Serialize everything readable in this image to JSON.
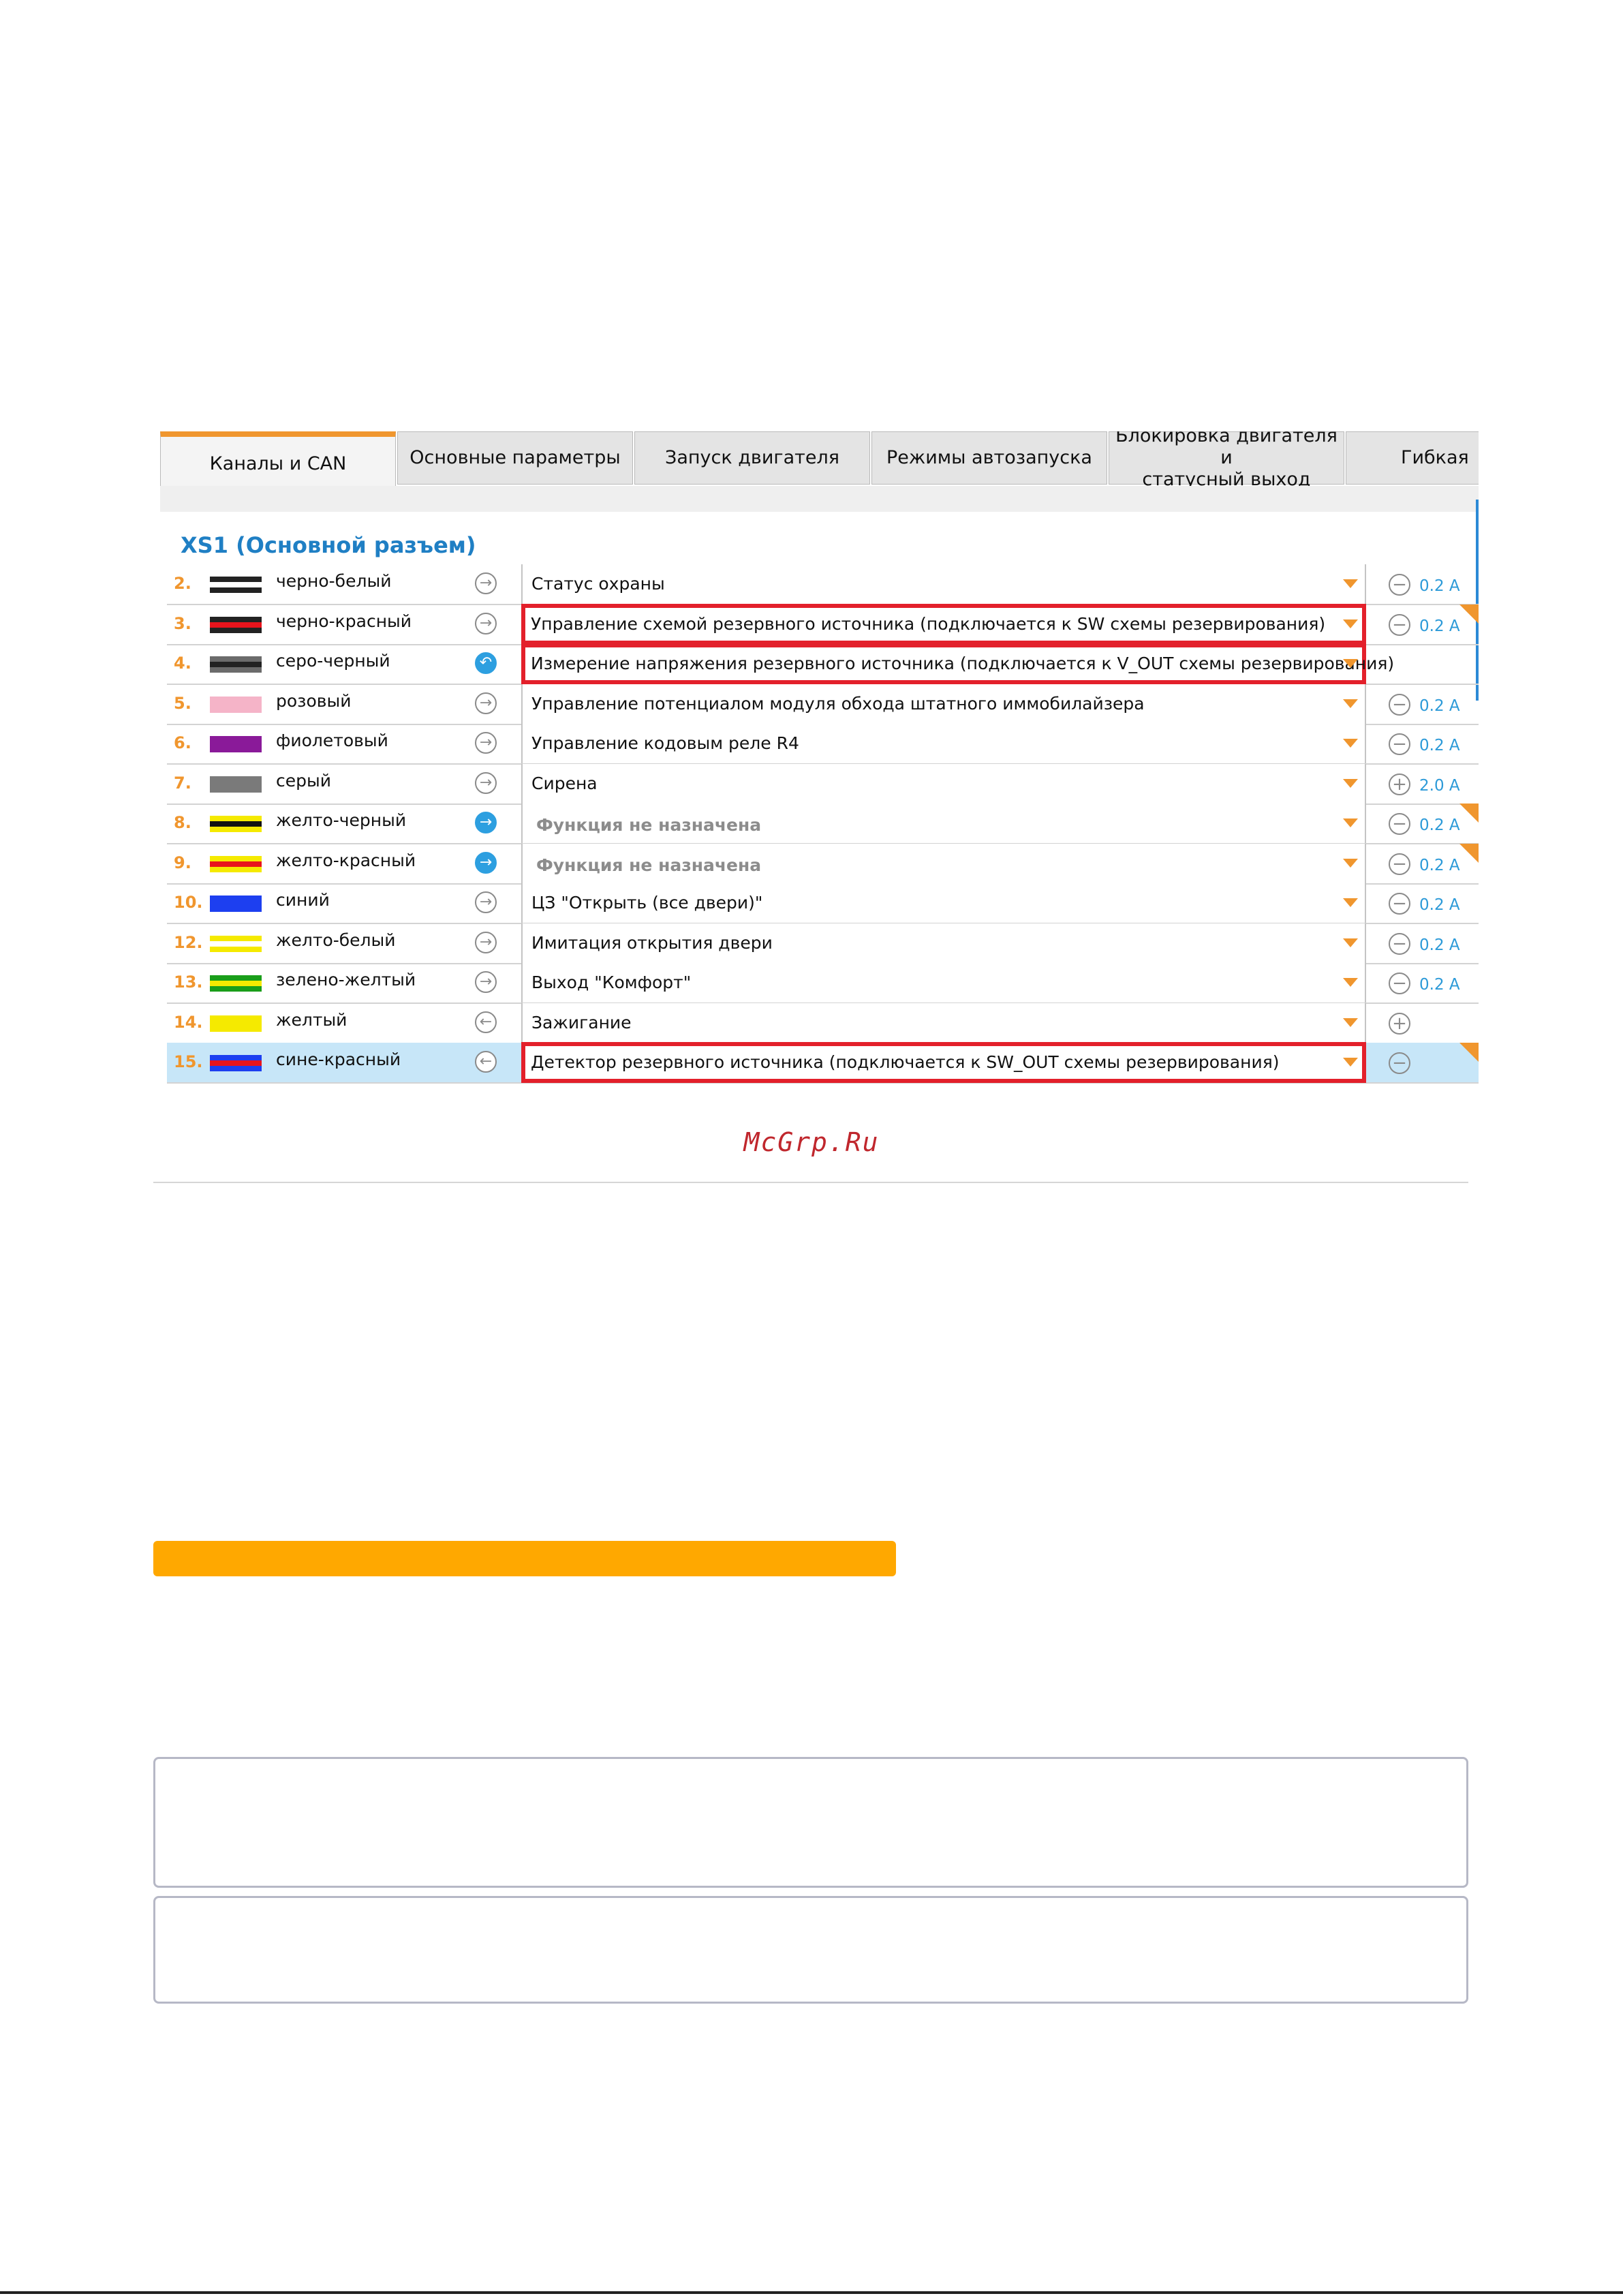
{
  "tabs": [
    {
      "label": "Каналы и CAN",
      "active": true
    },
    {
      "label": "Основные параметры"
    },
    {
      "label": "Запуск двигателя"
    },
    {
      "label": "Режимы автозапуска"
    },
    {
      "label": "Блокировка двигателя и\nстатусный выход"
    },
    {
      "label": "Гибкая"
    }
  ],
  "section_title": "XS1 (Основной разъем)",
  "rows": [
    {
      "num": "2.",
      "wire": "черно-белый",
      "colors": [
        "#222222",
        "#ffffff",
        "#222222"
      ],
      "dir": "out",
      "function": "Статус охраны",
      "sign": "minus",
      "amp": "0.2 A"
    },
    {
      "num": "3.",
      "wire": "черно-красный",
      "colors": [
        "#222222",
        "#e8141c",
        "#222222"
      ],
      "dir": "out",
      "function": "Управление схемой резервного источника (подключается к SW схемы резервирования)",
      "highlight": true,
      "sign": "minus",
      "amp": "0.2 A",
      "corner": true
    },
    {
      "num": "4.",
      "wire": "серо-черный",
      "colors": [
        "#6b6b6b",
        "#222222",
        "#6b6b6b"
      ],
      "dir": "analog",
      "function": "Измерение напряжения резервного источника (подключается к V_OUT схемы резервирования)",
      "highlight": true
    },
    {
      "num": "5.",
      "wire": "розовый",
      "colors": [
        "#f5b4c8",
        "#f5b4c8",
        "#f5b4c8"
      ],
      "dir": "out",
      "function": "Управление потенциалом модуля обхода штатного иммобилайзера",
      "sign": "minus",
      "amp": "0.2 A"
    },
    {
      "num": "6.",
      "wire": "фиолетовый",
      "colors": [
        "#8a1a99",
        "#8a1a99",
        "#8a1a99"
      ],
      "dir": "out",
      "function": "Управление кодовым реле R4",
      "sign": "minus",
      "amp": "0.2 A"
    },
    {
      "num": "7.",
      "wire": "серый",
      "colors": [
        "#7a7a7a",
        "#7a7a7a",
        "#7a7a7a"
      ],
      "dir": "out",
      "function": "Сирена",
      "sign": "plus",
      "amp": "2.0 A"
    },
    {
      "num": "8.",
      "wire": "желто-черный",
      "colors": [
        "#f5ea00",
        "#111111",
        "#f5ea00"
      ],
      "dir": "out-blue",
      "function": "Функция не назначена",
      "unassigned": true,
      "sign": "minus",
      "amp": "0.2 A",
      "corner": true
    },
    {
      "num": "9.",
      "wire": "желто-красный",
      "colors": [
        "#f5ea00",
        "#e8141c",
        "#f5ea00"
      ],
      "dir": "out-blue",
      "function": "Функция не назначена",
      "unassigned": true,
      "sign": "minus",
      "amp": "0.2 A",
      "corner": true
    },
    {
      "num": "10.",
      "wire": "синий",
      "colors": [
        "#1d3ff0",
        "#1d3ff0",
        "#1d3ff0"
      ],
      "dir": "out",
      "function": "ЦЗ \"Открыть (все двери)\"",
      "sign": "minus",
      "amp": "0.2 A"
    },
    {
      "num": "12.",
      "wire": "желто-белый",
      "colors": [
        "#f5ea00",
        "#ffffff",
        "#f5ea00"
      ],
      "dir": "out",
      "function": "Имитация открытия двери",
      "sign": "minus",
      "amp": "0.2 A"
    },
    {
      "num": "13.",
      "wire": "зелено-желтый",
      "colors": [
        "#1a9e1a",
        "#f5ea00",
        "#1a9e1a"
      ],
      "dir": "out",
      "function": "Выход \"Комфорт\"",
      "sign": "minus",
      "amp": "0.2 A"
    },
    {
      "num": "14.",
      "wire": "желтый",
      "colors": [
        "#f5ea00",
        "#f5ea00",
        "#f5ea00"
      ],
      "dir": "in",
      "function": "Зажигание",
      "sign": "plus"
    },
    {
      "num": "15.",
      "wire": "сине-красный",
      "colors": [
        "#1d3ff0",
        "#e8141c",
        "#1d3ff0"
      ],
      "dir": "in",
      "function": "Детектор резервного источника (подключается к SW_OUT схемы резервирования)",
      "highlight": true,
      "sign": "minus",
      "corner": true,
      "selected": true
    }
  ],
  "site_watermark": "McGrp.Ru",
  "accent_colors": {
    "orange": "#f0962e",
    "blue": "#1f7fc4",
    "highlight": "#e3202b",
    "bar": "#ffa800"
  }
}
